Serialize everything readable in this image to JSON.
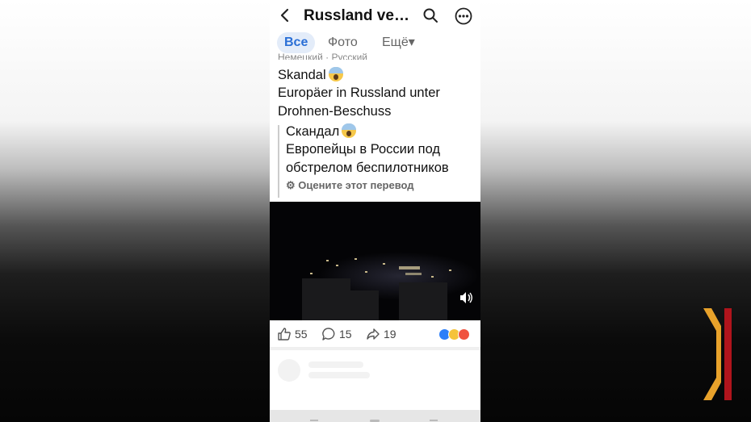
{
  "header": {
    "title": "Russland vers…"
  },
  "tabs": [
    {
      "label": "Все",
      "active": true
    },
    {
      "label": "Фото",
      "active": false
    },
    {
      "label": "Ещё▾",
      "active": false
    }
  ],
  "post": {
    "language_label": "Немецкий · Русский",
    "original": {
      "line1": "Skandal",
      "line2": "Europäer in Russland unter",
      "line3": "Drohnen-Beschuss"
    },
    "translation": {
      "line1": "Скандал",
      "line2": "Европейцы в России под",
      "line3": "обстрелом беспилотников"
    },
    "rate_translation": "Оцените этот перевод",
    "emoji": "screaming-face-emoji"
  },
  "actions": {
    "likes": "55",
    "comments": "15",
    "shares": "19",
    "reaction_icons": [
      "like-reaction-icon",
      "sad-reaction-icon",
      "love-reaction-icon"
    ]
  },
  "colors": {
    "accent": "#2a6fd6",
    "tab_active_bg": "#e3ecf9",
    "logo_orange": "#e8a22b",
    "logo_red": "#b0141c"
  }
}
